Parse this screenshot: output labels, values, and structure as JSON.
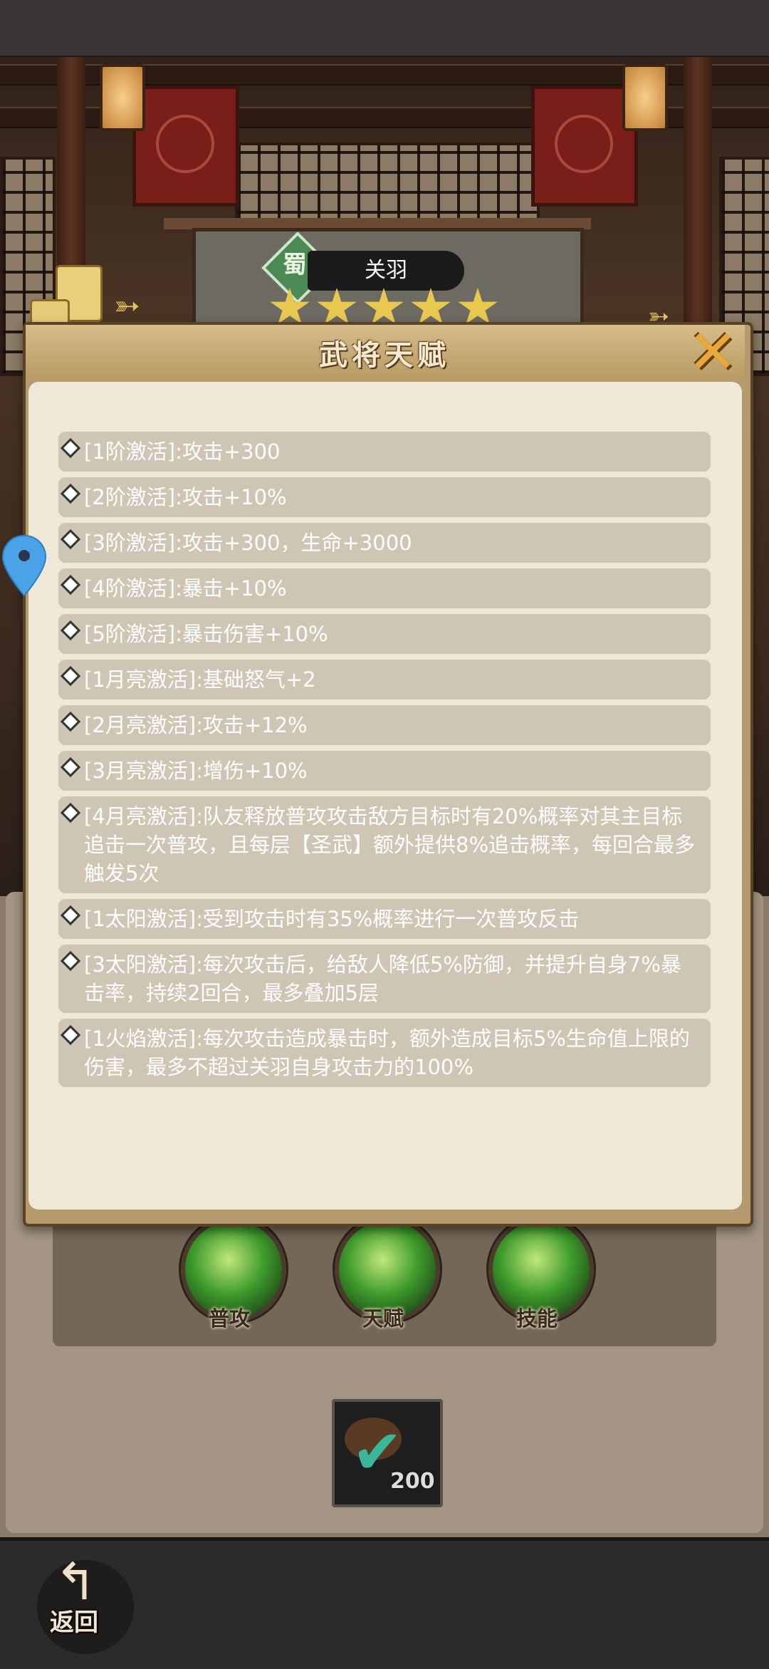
{
  "hero": {
    "faction": "蜀",
    "name": "关羽",
    "stars": 5
  },
  "dialog": {
    "title": "武将天赋",
    "close_icon": "close-x-icon",
    "talents": [
      "[1阶激活]:攻击+300",
      "[2阶激活]:攻击+10%",
      "[3阶激活]:攻击+300，生命+3000",
      "[4阶激活]:暴击+10%",
      "[5阶激活]:暴击伤害+10%",
      "[1月亮激活]:基础怒气+2",
      "[2月亮激活]:攻击+12%",
      "[3月亮激活]:增伤+10%",
      "[4月亮激活]:队友释放普攻攻击敌方目标时有20%概率对其主目标追击一次普攻，且每层【圣武】额外提供8%追击概率，每回合最多触发5次",
      "[1太阳激活]:受到攻击时有35%概率进行一次普攻反击",
      "[3太阳激活]:每次攻击后，给敌人降低5%防御，并提升自身7%暴击率，持续2回合，最多叠加5层",
      "[1火焰激活]:每次攻击造成暴击时，额外造成目标5%生命值上限的伤害，最多不超过关羽自身攻击力的100%"
    ]
  },
  "skills": [
    {
      "label": "普攻"
    },
    {
      "label": "天赋"
    },
    {
      "label": "技能"
    }
  ],
  "item": {
    "count": "200",
    "icon": "check-item-icon"
  },
  "footer": {
    "back_label": "返回",
    "back_icon": "back-arrow-icon"
  }
}
